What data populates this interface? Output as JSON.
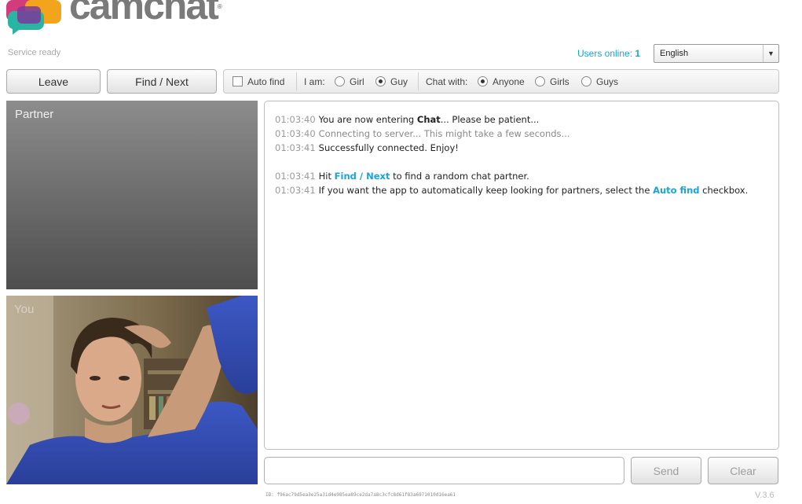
{
  "brand": {
    "name": "camchat"
  },
  "status": {
    "text": "Service ready"
  },
  "users_online": {
    "label": "Users online:",
    "count": "1"
  },
  "language": {
    "selected": "English"
  },
  "toolbar": {
    "leave_label": "Leave",
    "next_label": "Find / Next",
    "auto_find_label": "Auto find",
    "i_am_label": "I am:",
    "i_am_options": [
      {
        "label": "Girl",
        "selected": false
      },
      {
        "label": "Guy",
        "selected": true
      }
    ],
    "chat_with_label": "Chat with:",
    "chat_with_options": [
      {
        "label": "Anyone",
        "selected": true
      },
      {
        "label": "Girls",
        "selected": false
      },
      {
        "label": "Guys",
        "selected": false
      }
    ]
  },
  "video": {
    "partner_label": "Partner",
    "self_label": "You"
  },
  "chat": {
    "messages": [
      {
        "time": "01:03:40",
        "parts": [
          "You are now entering ",
          "Chat",
          "... Please be patient..."
        ]
      },
      {
        "time": "01:03:40",
        "text": "Connecting to server... This might take a few seconds..."
      },
      {
        "time": "01:03:41",
        "text": "Successfully connected. Enjoy!"
      },
      {
        "time": "01:03:41",
        "parts": [
          "Hit ",
          "Find / Next",
          " to find a random chat partner."
        ]
      },
      {
        "time": "01:03:41",
        "parts": [
          "If you want the app to automatically keep looking for partners, select the ",
          "Auto find",
          " checkbox."
        ]
      }
    ]
  },
  "input": {
    "value": "",
    "send_label": "Send",
    "clear_label": "Clear"
  },
  "footer": {
    "session_id": "ID: f96ac79d5ea3e25a31d4e985ea89ce2da7a8c3cfc8d61f83a6971010d16ea61",
    "version": "V.3.6"
  },
  "colors": {
    "accent": "#1aa3d6",
    "text": "#222222",
    "muted": "#9a9a9a"
  },
  "icons": {
    "checkbox": "checkbox-icon",
    "radio": "radio-icon",
    "dropdown": "chevron-down-icon"
  }
}
